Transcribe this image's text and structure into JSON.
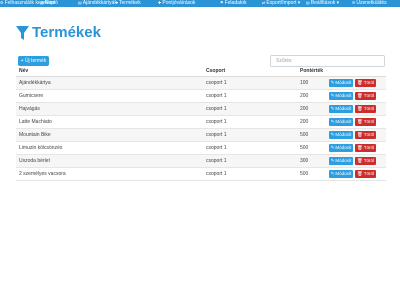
{
  "nav": {
    "items": [
      {
        "icon": "⚙",
        "label": "Felhasználók kezelése"
      },
      {
        "icon": "▤",
        "label": "Napló"
      },
      {
        "icon": "▤",
        "label": "Ajándékkártyák"
      },
      {
        "icon": "▾",
        "label": "Termékek"
      },
      {
        "icon": "✚",
        "label": "Pontjóváírások"
      },
      {
        "icon": "⚑",
        "label": "Feladatok"
      },
      {
        "icon": "⇄",
        "label": "Export/Import ▾"
      },
      {
        "icon": "▤",
        "label": "Beállítások ▾"
      },
      {
        "icon": "✉",
        "label": "Üzenetküldés"
      }
    ]
  },
  "page": {
    "title": "Termékek",
    "add_button": "+ Új termék",
    "search_placeholder": "Szűrés"
  },
  "table": {
    "headers": [
      "Név",
      "Csoport",
      "Pontérték"
    ],
    "edit_label": "Módosít",
    "delete_label": "Töröl",
    "rows": [
      {
        "name": "Ajándékkártya",
        "group": "csoport 1",
        "points": "100"
      },
      {
        "name": "Gumicsere",
        "group": "csoport 1",
        "points": "200"
      },
      {
        "name": "Hajvágás",
        "group": "csoport 1",
        "points": "200"
      },
      {
        "name": "Latte Machiato",
        "group": "csoport 1",
        "points": "200"
      },
      {
        "name": "Mountain Bike",
        "group": "csoport 1",
        "points": "500"
      },
      {
        "name": "Limuzin kölcsönzés",
        "group": "csoport 1",
        "points": "500"
      },
      {
        "name": "Uszoda bérlet",
        "group": "csoport 1",
        "points": "300"
      },
      {
        "name": "2 személyes vacsora",
        "group": "csoport 1",
        "points": "500"
      }
    ]
  },
  "colors": {
    "accent": "#2a94d6",
    "edit": "#2d9ee0",
    "delete": "#cc2d2d"
  }
}
